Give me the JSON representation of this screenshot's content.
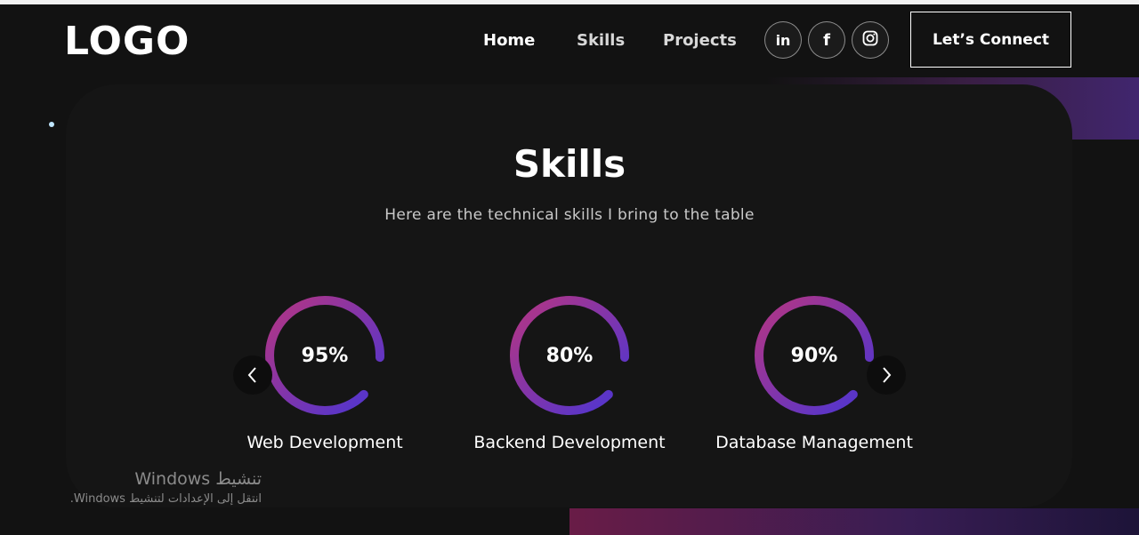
{
  "nav": {
    "logo": "LOGO",
    "links": [
      "Home",
      "Skills",
      "Projects"
    ],
    "social": [
      {
        "icon": "linkedin-icon",
        "glyph": "in"
      },
      {
        "icon": "facebook-icon",
        "glyph": "f"
      },
      {
        "icon": "instagram-icon",
        "glyph": ""
      }
    ],
    "connect_label": "Let’s Connect"
  },
  "skills": {
    "title": "Skills",
    "subtitle": "Here are the technical skills I bring to the table",
    "items": [
      {
        "name": "Web Development",
        "percent_label": "95%",
        "percent": 95
      },
      {
        "name": "Backend Development",
        "percent_label": "80%",
        "percent": 80
      },
      {
        "name": "Database Management",
        "percent_label": "90%",
        "percent": 90
      }
    ],
    "prev_icon": "chevron-left-icon",
    "next_icon": "chevron-right-icon"
  },
  "watermark": {
    "line1": "تنشيط Windows",
    "line2": "انتقل إلى الإعدادات لتنشيط Windows."
  },
  "colors": {
    "background": "#121212",
    "ring_start": "#a6358e",
    "ring_end": "#5a35c8"
  }
}
